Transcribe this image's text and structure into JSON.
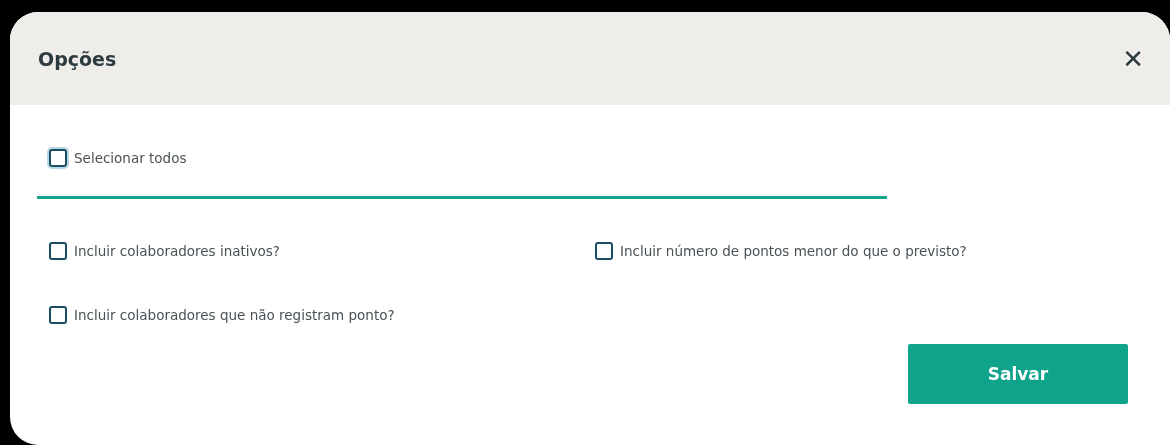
{
  "dialog": {
    "title": "Opções",
    "close": "✕"
  },
  "select_all": {
    "label": "Selecionar todos",
    "checked": false
  },
  "options": [
    {
      "label": "Incluir colaboradores inativos?",
      "checked": false
    },
    {
      "label": "Incluir número de pontos menor do que o previsto?",
      "checked": false
    },
    {
      "label": "Incluir colaboradores que não registram ponto?",
      "checked": false
    }
  ],
  "buttons": [
    "Salvar"
  ]
}
